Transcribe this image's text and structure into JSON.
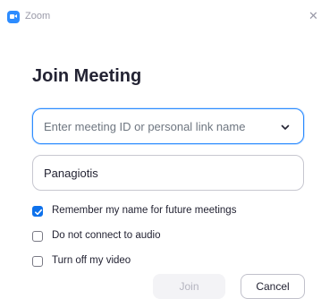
{
  "window": {
    "title": "Zoom",
    "app_icon": "zoom-camera-icon",
    "close_icon": "close-icon"
  },
  "dialog": {
    "heading": "Join Meeting",
    "meeting_id": {
      "value": "",
      "placeholder": "Enter meeting ID or personal link name",
      "dropdown_icon": "chevron-down-icon"
    },
    "name": {
      "value": "Panagiotis"
    },
    "options": [
      {
        "label": "Remember my name for future meetings",
        "checked": true
      },
      {
        "label": "Do not connect to audio",
        "checked": false
      },
      {
        "label": "Turn off my video",
        "checked": false
      }
    ],
    "buttons": {
      "join_label": "Join",
      "join_enabled": false,
      "cancel_label": "Cancel"
    }
  },
  "colors": {
    "accent": "#2D8CFF",
    "checkbox_checked": "#0E71EB",
    "text": "#232333",
    "muted": "#9a9aa8"
  }
}
